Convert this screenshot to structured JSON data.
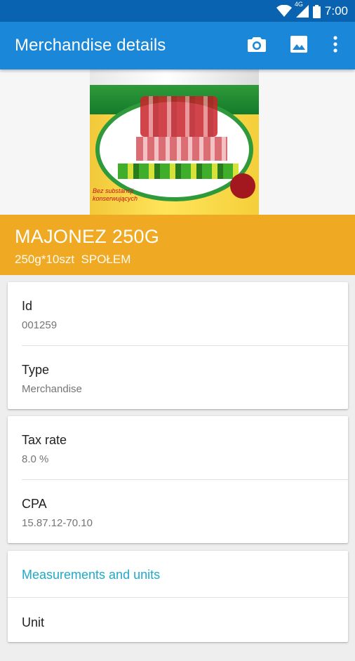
{
  "status_bar": {
    "time": "7:00",
    "network": "4G",
    "icons": [
      "wifi-icon",
      "signal-icon",
      "battery-icon"
    ]
  },
  "app_bar": {
    "title": "Merchandise details",
    "actions": [
      "camera-icon",
      "image-icon",
      "more-vert-icon"
    ]
  },
  "hero": {
    "jar_text": "Bez substancji konserwujących"
  },
  "product": {
    "name": "MAJONEZ 250G",
    "subtitle": "250g*10szt  SPOŁEM"
  },
  "cards": {
    "basic": {
      "id_label": "Id",
      "id_value": "001259",
      "type_label": "Type",
      "type_value": "Merchandise"
    },
    "tax": {
      "tax_label": "Tax rate",
      "tax_value": "8.0 %",
      "cpa_label": "CPA",
      "cpa_value": "15.87.12-70.10"
    },
    "measurements": {
      "section_title": "Measurements and units",
      "unit_label": "Unit"
    }
  },
  "colors": {
    "status_bar": "#0a63b0",
    "app_bar": "#1a87d9",
    "header_band": "#f0a923",
    "section_title": "#1eaac8"
  }
}
